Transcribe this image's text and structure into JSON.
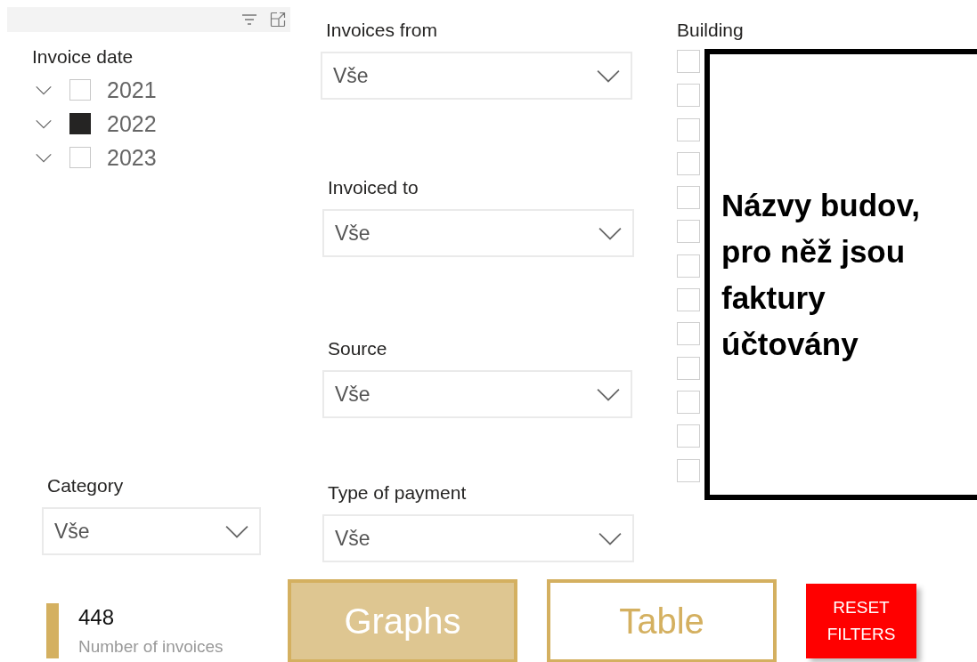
{
  "invoice_date": {
    "title": "Invoice date",
    "items": [
      {
        "label": "2021",
        "checked": false
      },
      {
        "label": "2022",
        "checked": true
      },
      {
        "label": "2023",
        "checked": false
      }
    ]
  },
  "dropdowns": [
    {
      "title": "Invoices from",
      "value": "Vše"
    },
    {
      "title": "Invoiced to",
      "value": "Vše"
    },
    {
      "title": "Source",
      "value": "Vše"
    },
    {
      "title": "Type of payment",
      "value": "Vše"
    }
  ],
  "building": {
    "title": "Building",
    "items": [
      {
        "checked": false
      },
      {
        "checked": false
      },
      {
        "checked": false
      },
      {
        "checked": false
      },
      {
        "checked": false
      },
      {
        "checked": false
      },
      {
        "checked": false
      },
      {
        "checked": false
      },
      {
        "checked": false
      },
      {
        "checked": false
      },
      {
        "checked": false
      },
      {
        "checked": false
      },
      {
        "checked": false
      }
    ]
  },
  "annotation": {
    "text": "Názvy budov, pro něž jsou faktury účtovány"
  },
  "category": {
    "title": "Category",
    "value": "Vše"
  },
  "kpi": {
    "value": "448",
    "label": "Number of invoices"
  },
  "nav_buttons": [
    {
      "label": "Graphs",
      "selected": true
    },
    {
      "label": "Table",
      "selected": false
    }
  ],
  "reset_button": {
    "label": "RESET FILTERS"
  }
}
